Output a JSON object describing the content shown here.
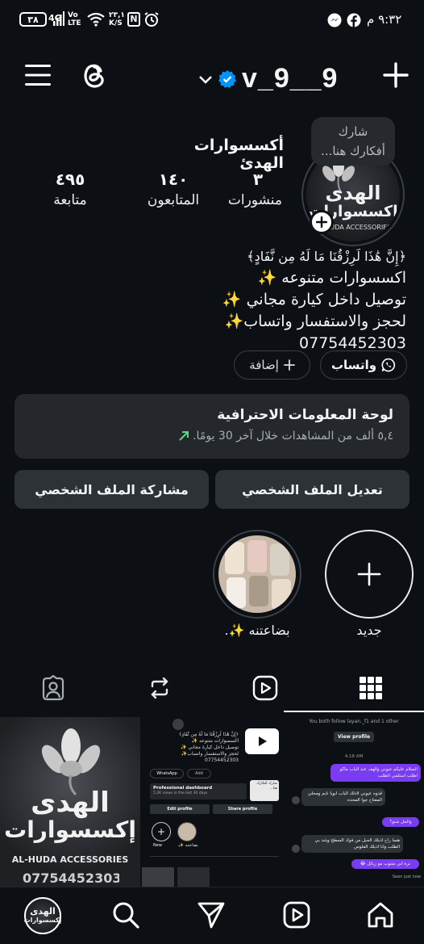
{
  "status_bar": {
    "time": "٩:٣٢ م",
    "battery": "٣٨",
    "network": "4G",
    "volte": "Vo LTE",
    "speed": "٢٣,١ K/S"
  },
  "header": {
    "username": "v_9__9",
    "menu_icon": "menu-icon",
    "threads_icon": "threads-icon",
    "verified_icon": "verified-badge-icon",
    "add_icon": "plus-icon"
  },
  "profile": {
    "name": "أكسسوارات الهدئ",
    "note_bubble": "شارك أفكارك هنا...",
    "avatar_text_top": "الهدى",
    "avatar_text_bottom": "إكسسوارات",
    "avatar_text_en": "AL-HUDA ACCESSORIES",
    "stats": [
      {
        "value": "٣",
        "label": "منشورات"
      },
      {
        "value": "١٤٠",
        "label": "المتابعون"
      },
      {
        "value": "٤٩٥",
        "label": "متابعة"
      }
    ],
    "bio": [
      "﴿إِنَّ هَٰذَا لَرِزْقُنَا مَا لَهُ مِن نَّفَادٍ﴾",
      "اكسسوارات متنوعه ✨",
      "توصيل داخل كيارة مجاني ✨",
      "لحجز والاستفسار واتساب✨",
      "07754452303"
    ],
    "whatsapp_label": "واتساب",
    "add_label": "إضافة"
  },
  "dashboard": {
    "title": "لوحة المعلومات الاحترافية",
    "subtitle": "٥,٤ ألف من المشاهدات خلال آخر 30 يومًا."
  },
  "buttons": {
    "edit_profile": "تعديل الملف الشخصي",
    "share_profile": "مشاركة الملف الشخصي"
  },
  "highlights": [
    {
      "label": "جديد"
    },
    {
      "label": "بضاعتنه ✨."
    }
  ],
  "tabs": [
    "grid-icon",
    "reels-icon",
    "reposts-icon",
    "tagged-icon"
  ],
  "posts": {
    "post2": {
      "whatsapp": "WhatsApp",
      "add": "Add",
      "dash_title": "Professional dashboard",
      "dash_sub": "5.2K views in the last 30 days.",
      "edit": "Edit profile",
      "share": "Share profile",
      "new": "New",
      "hl": "بضاعتنه ✨."
    },
    "post3": {
      "follow": "You both follow layan._f1 and 1 other",
      "view_profile": "View profile",
      "time": "4:18 AM",
      "msg1": "السلام عليكم عيوني والهف عند الباب ماكو اطلب استلمي الطلب",
      "msg2": "قدوه عيوني لادلك الباب ابويا نايم ومحلي المفتاح جوا المحده",
      "msg3": "والحل شنو؟",
      "msg4": "هسا راح اذبلك الحبل من فوك السطح وشد بي الطلب وانا اذبلك الفلوس",
      "msg5": "ترة اني متنوب مو زبائل 😂",
      "seen": "Seen just now"
    }
  },
  "nav": [
    "profile-avatar",
    "search-icon",
    "send-icon",
    "reels-icon",
    "home-icon"
  ],
  "colors": {
    "background": "#0c1014",
    "card": "#24282d",
    "button": "#2d3237",
    "verified": "#0095f6",
    "trend_green": "#5fd38b",
    "dm_purple": "#7a3cf0"
  }
}
